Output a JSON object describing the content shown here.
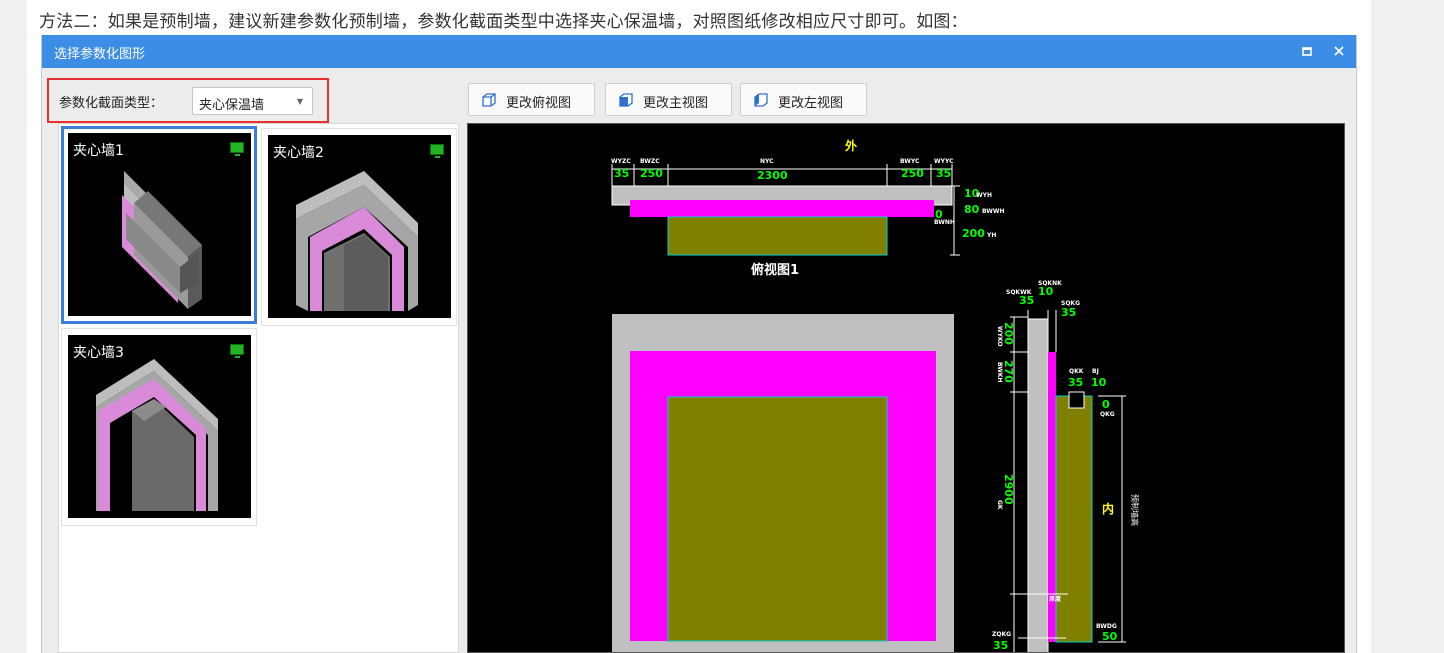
{
  "intro_text": "方法二：如果是预制墙，建议新建参数化预制墙，参数化截面类型中选择夹心保温墙，对照图纸修改相应尺寸即可。如图：",
  "dialog": {
    "title": "选择参数化图形",
    "maximize_icon": "maximize-icon",
    "close_icon": "close-icon"
  },
  "section_type": {
    "label": "参数化截面类型：",
    "value": "夹心保温墙"
  },
  "toolbar": {
    "buttons": [
      {
        "label": "更改俯视图",
        "icon": "top-view-icon"
      },
      {
        "label": "更改主视图",
        "icon": "front-view-icon"
      },
      {
        "label": "更改左视图",
        "icon": "left-view-icon"
      }
    ]
  },
  "gallery": {
    "items": [
      {
        "title": "夹心墙1",
        "selected": true
      },
      {
        "title": "夹心墙2",
        "selected": false
      },
      {
        "title": "夹心墙3",
        "selected": false
      }
    ]
  },
  "drawing": {
    "exterior_label": "外",
    "interior_label": "内",
    "top_view_title": "俯视图1",
    "top_dims": {
      "codes": [
        "WYZC",
        "BWZC",
        "NYC",
        "BWYC",
        "WYYC"
      ],
      "values": [
        "35",
        "250",
        "2300",
        "250",
        "35"
      ]
    },
    "right_dims": {
      "values": [
        "10",
        "80",
        "0",
        "200"
      ],
      "codes": [
        "WYH",
        "BWWH",
        "BWNH",
        "YH"
      ]
    },
    "side_top_codes": [
      "SQKWK",
      "SQKNK",
      "SQKG"
    ],
    "side_top_values": [
      "35",
      "10",
      "35"
    ],
    "side_vertical_values": [
      "200",
      "270",
      "2900"
    ],
    "side_vertical_codes": [
      "WYKO",
      "BWKH",
      "GK"
    ],
    "side_mid_codes": [
      "QKK",
      "BJ"
    ],
    "side_mid_values": [
      "35",
      "10"
    ],
    "qkg_code": "QKG",
    "qkg_value": "0",
    "height_code": "预制墙高",
    "box_label": "厚度",
    "bottom_code": "BWDG",
    "bottom_value": "50",
    "bottom_left_code": "ZQKG",
    "bottom_left_value": "35"
  },
  "colors": {
    "titlebar": "#3c8de6",
    "highlight_box": "#e8312f",
    "selection": "#3b7ddd",
    "insulation": "#ff00ff",
    "inner_wythe": "#808000",
    "outer_wythe": "#c0c0c0",
    "dimension_text": "#00ff00",
    "label_text": "#ffff00"
  }
}
